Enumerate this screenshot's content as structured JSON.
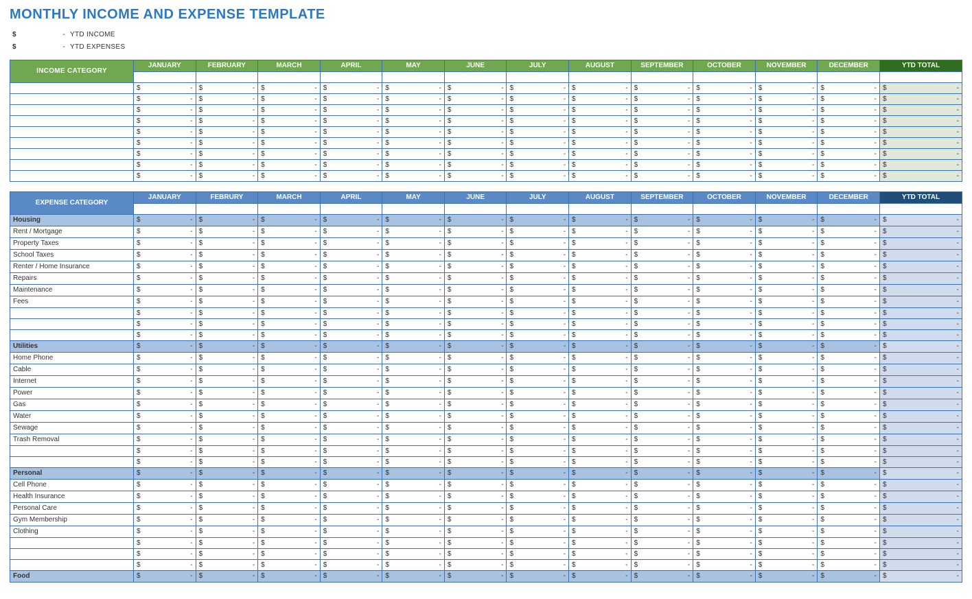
{
  "title": "MONTHLY INCOME AND EXPENSE TEMPLATE",
  "summary": {
    "income_label": "YTD INCOME",
    "expenses_label": "YTD EXPENSES",
    "currency": "$",
    "dash": "-"
  },
  "months": [
    "JANUARY",
    "FEBRUARY",
    "MARCH",
    "APRIL",
    "MAY",
    "JUNE",
    "JULY",
    "AUGUST",
    "SEPTEMBER",
    "OCTOBER",
    "NOVEMBER",
    "DECEMBER"
  ],
  "months_exp": [
    "JANUARY",
    "FEBRURY",
    "MARCH",
    "APRIL",
    "MAY",
    "JUNE",
    "JULY",
    "AUGUST",
    "SEPTEMBER",
    "OCTOBER",
    "NOVEMBER",
    "DECEMBER"
  ],
  "ytd_total_label": "YTD TOTAL",
  "income_category_label": "INCOME CATEGORY",
  "expense_category_label": "EXPENSE CATEGORY",
  "cell": {
    "currency": "$",
    "dash": "-"
  },
  "income_rows": [
    "",
    "",
    "",
    "",
    "",
    "",
    "",
    "",
    ""
  ],
  "expense_rows": [
    {
      "label": "Housing",
      "sub": true
    },
    {
      "label": "Rent / Mortgage"
    },
    {
      "label": "Property Taxes"
    },
    {
      "label": "School Taxes"
    },
    {
      "label": "Renter / Home Insurance"
    },
    {
      "label": "Repairs"
    },
    {
      "label": "Maintenance"
    },
    {
      "label": "Fees"
    },
    {
      "label": ""
    },
    {
      "label": ""
    },
    {
      "label": ""
    },
    {
      "label": "Utilities",
      "sub": true
    },
    {
      "label": "Home Phone"
    },
    {
      "label": "Cable"
    },
    {
      "label": "Internet"
    },
    {
      "label": "Power"
    },
    {
      "label": "Gas"
    },
    {
      "label": "Water"
    },
    {
      "label": "Sewage"
    },
    {
      "label": "Trash Removal"
    },
    {
      "label": ""
    },
    {
      "label": ""
    },
    {
      "label": "Personal",
      "sub": true
    },
    {
      "label": "Cell Phone"
    },
    {
      "label": "Health Insurance"
    },
    {
      "label": "Personal Care"
    },
    {
      "label": "Gym Membership"
    },
    {
      "label": "Clothing"
    },
    {
      "label": ""
    },
    {
      "label": ""
    },
    {
      "label": ""
    },
    {
      "label": "Food",
      "sub": true
    }
  ]
}
